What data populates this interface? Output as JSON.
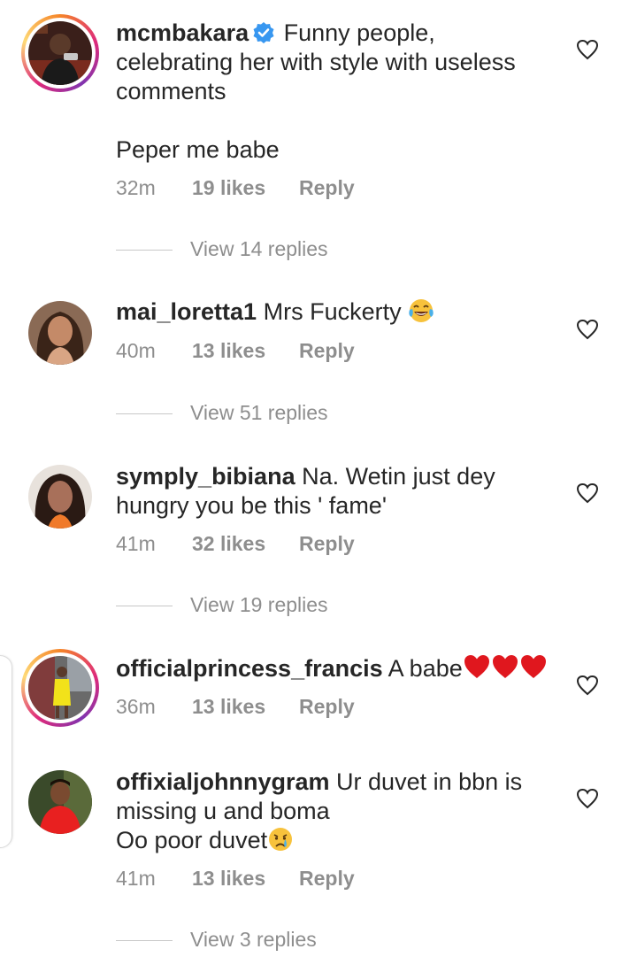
{
  "comments": [
    {
      "username": "mcmbakara",
      "verified": true,
      "text_line1": "Funny people,",
      "text_line2": "celebrating her with style with useless",
      "text_line3": "comments",
      "text_line4": "Peper me babe",
      "time": "32m",
      "likes": "19 likes",
      "reply": "Reply",
      "view_replies": "View 14 replies"
    },
    {
      "username": "mai_loretta1",
      "text_line1": "Mrs Fuckerty",
      "emoji": "face-with-tears-of-joy",
      "time": "40m",
      "likes": "13 likes",
      "reply": "Reply",
      "view_replies": "View 51 replies"
    },
    {
      "username": "symply_bibiana",
      "text_line1": "Na. Wetin just dey",
      "text_line2": "hungry you be this ' fame'",
      "time": "41m",
      "likes": "32 likes",
      "reply": "Reply",
      "view_replies": "View 19 replies"
    },
    {
      "username": "officialprincess_francis",
      "text_line1": "A babe",
      "emoji": "red-heart x3",
      "time": "36m",
      "likes": "13 likes",
      "reply": "Reply"
    },
    {
      "username": "offixialjohnnygram",
      "text_line1": "Ur duvet in bbn is",
      "text_line2": "missing u and boma",
      "text_line3": "Oo poor duvet",
      "emoji": "crying-face",
      "time": "41m",
      "likes": "13 likes",
      "reply": "Reply",
      "view_replies": "View 3 replies"
    }
  ],
  "colors": {
    "text": "#262626",
    "muted": "#8e8e8e",
    "verified": "#3897f0",
    "heart_red": "#e0171e"
  }
}
